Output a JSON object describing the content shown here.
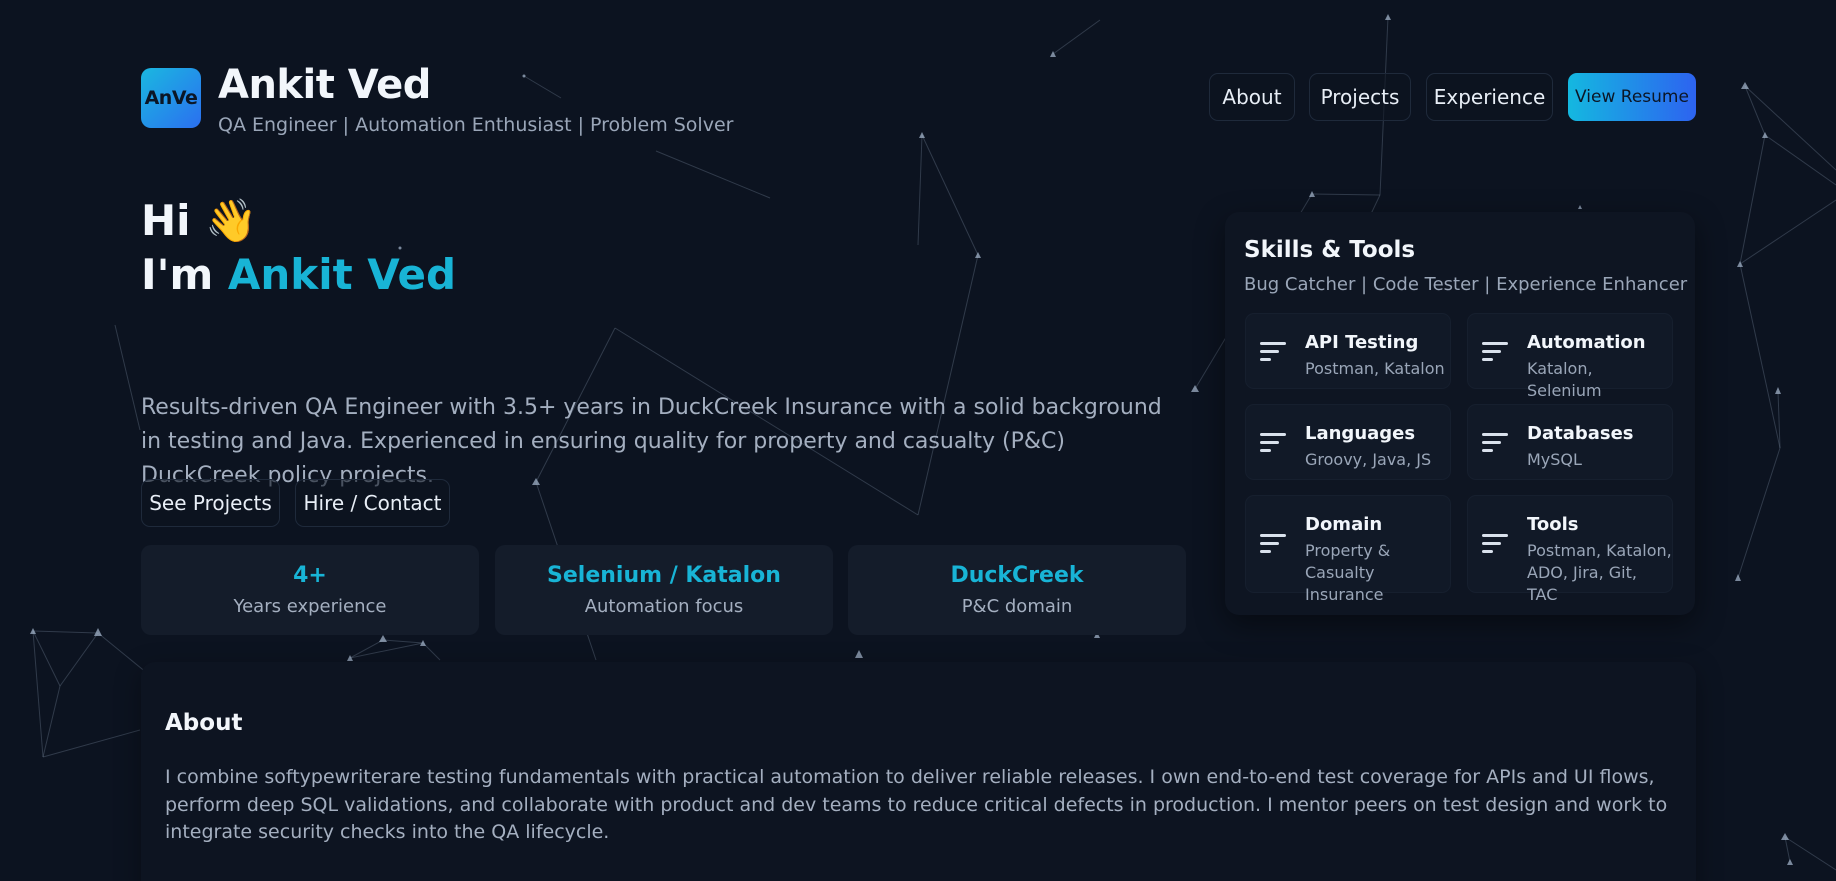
{
  "header": {
    "logo_text": "AnVe",
    "name": "Ankit Ved",
    "tagline": "QA Engineer | Automation Enthusiast | Problem Solver"
  },
  "nav": {
    "about": "About",
    "projects": "Projects",
    "experience": "Experience",
    "resume": "View Resume"
  },
  "hero": {
    "greeting": "Hi 👋",
    "intro_prefix": "I'm ",
    "intro_name": "Ankit Ved",
    "description": "Results-driven QA Engineer with 3.5+ years in DuckCreek Insurance with a solid background in testing and Java. Experienced in ensuring quality for property and casualty (P&C) DuckCreek policy projects.",
    "see_projects": "See Projects",
    "hire_contact": "Hire / Contact"
  },
  "stats": [
    {
      "value": "4+",
      "label": "Years experience"
    },
    {
      "value": "Selenium / Katalon",
      "label": "Automation focus"
    },
    {
      "value": "DuckCreek",
      "label": "P&C domain"
    }
  ],
  "skills": {
    "title": "Skills & Tools",
    "subtitle": "Bug Catcher | Code Tester | Experience Enhancer",
    "items": [
      {
        "name": "API Testing",
        "value": "Postman, Katalon"
      },
      {
        "name": "Automation",
        "value": "Katalon, Selenium"
      },
      {
        "name": "Languages",
        "value": "Groovy, Java, JS"
      },
      {
        "name": "Databases",
        "value": "MySQL"
      },
      {
        "name": "Domain",
        "value": "Property & Casualty Insurance"
      },
      {
        "name": "Tools",
        "value": "Postman, Katalon, ADO, Jira, Git, TAC"
      }
    ]
  },
  "about": {
    "title": "About",
    "text": "I combine softypewriterare testing fundamentals with practical automation to deliver reliable releases. I own end-to-end test coverage for APIs and UI flows, perform deep SQL validations, and collaborate with product and dev teams to reduce critical defects in production. I mentor peers on test design and work to integrate security checks into the QA lifecycle."
  },
  "icons": {
    "skill": "sort-lines-icon",
    "wave": "waving-hand-icon"
  },
  "colors": {
    "background": "#0c1320",
    "accent": "#18b4d6",
    "gradient_start": "#14b8e0",
    "gradient_end": "#2d63f0"
  }
}
